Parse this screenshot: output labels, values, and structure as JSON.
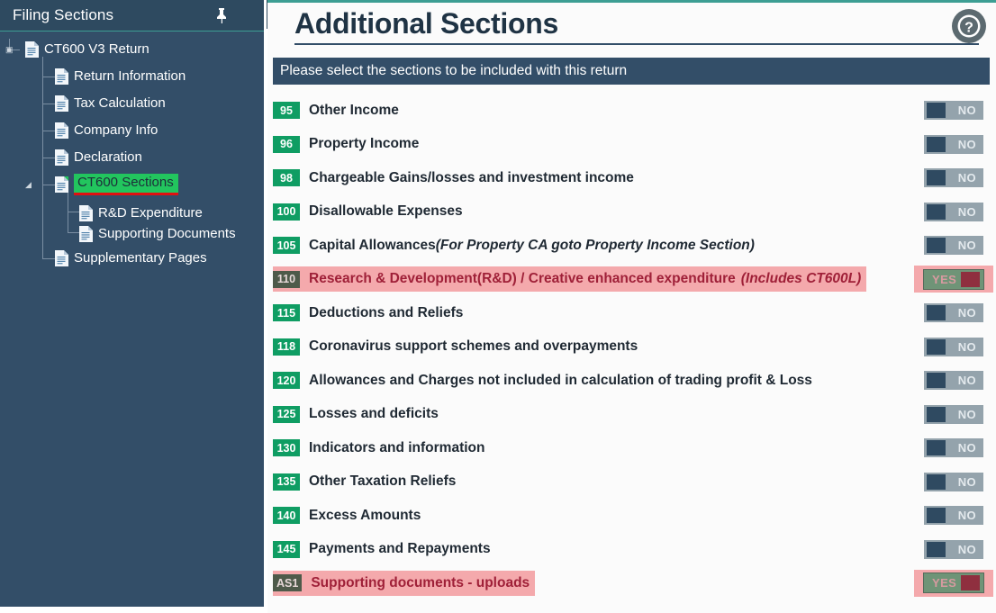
{
  "sidebar": {
    "title": "Filing Sections",
    "pin_icon": "pin-icon",
    "expand_label": "»",
    "tree": [
      {
        "label": "CT600 V3 Return",
        "level": 0,
        "selected": false
      },
      {
        "label": "Return Information",
        "level": 1,
        "selected": false
      },
      {
        "label": "Tax Calculation",
        "level": 1,
        "selected": false
      },
      {
        "label": "Company Info",
        "level": 1,
        "selected": false
      },
      {
        "label": "Declaration",
        "level": 1,
        "selected": false
      },
      {
        "label": "CT600 Sections",
        "level": 1,
        "selected": true
      },
      {
        "label": "R&D Expenditure",
        "level": 2,
        "selected": false
      },
      {
        "label": "Supporting Documents",
        "level": 2,
        "selected": false
      },
      {
        "label": "Supplementary Pages",
        "level": 1,
        "selected": false
      }
    ]
  },
  "main": {
    "page_title": "Additional Sections",
    "help_icon": "help-circle-icon",
    "instruction": "Please select the sections to be included with this return",
    "rows": [
      {
        "code": "95",
        "label": "Other Income",
        "note": "",
        "toggle": "NO",
        "highlight": false,
        "badge_muted": false
      },
      {
        "code": "96",
        "label": "Property Income",
        "note": "",
        "toggle": "NO",
        "highlight": false,
        "badge_muted": false
      },
      {
        "code": "98",
        "label": "Chargeable Gains/losses and investment income",
        "note": "",
        "toggle": "NO",
        "highlight": false,
        "badge_muted": false
      },
      {
        "code": "100",
        "label": "Disallowable Expenses",
        "note": "",
        "toggle": "NO",
        "highlight": false,
        "badge_muted": false
      },
      {
        "code": "105",
        "label": "Capital Allowances",
        "note": "(For Property CA goto Property Income Section)",
        "toggle": "NO",
        "highlight": false,
        "badge_muted": false
      },
      {
        "code": "110",
        "label": "Research & Development(R&D) / Creative enhanced expenditure",
        "note": "(Includes CT600L)",
        "toggle": "YES",
        "highlight": true,
        "badge_muted": true
      },
      {
        "code": "115",
        "label": "Deductions and Reliefs",
        "note": "",
        "toggle": "NO",
        "highlight": false,
        "badge_muted": false
      },
      {
        "code": "118",
        "label": "Coronavirus support schemes and overpayments",
        "note": "",
        "toggle": "NO",
        "highlight": false,
        "badge_muted": false
      },
      {
        "code": "120",
        "label": "Allowances and Charges not included in calculation of trading profit & Loss",
        "note": "",
        "toggle": "NO",
        "highlight": false,
        "badge_muted": false
      },
      {
        "code": "125",
        "label": "Losses and deficits",
        "note": "",
        "toggle": "NO",
        "highlight": false,
        "badge_muted": false
      },
      {
        "code": "130",
        "label": "Indicators and information",
        "note": "",
        "toggle": "NO",
        "highlight": false,
        "badge_muted": false
      },
      {
        "code": "135",
        "label": "Other Taxation Reliefs",
        "note": "",
        "toggle": "NO",
        "highlight": false,
        "badge_muted": false
      },
      {
        "code": "140",
        "label": "Excess Amounts",
        "note": "",
        "toggle": "NO",
        "highlight": false,
        "badge_muted": false
      },
      {
        "code": "145",
        "label": "Payments and Repayments",
        "note": "",
        "toggle": "NO",
        "highlight": false,
        "badge_muted": false
      },
      {
        "code": "AS1",
        "label": "Supporting documents - uploads",
        "note": "",
        "toggle": "YES",
        "highlight": true,
        "badge_muted": true
      }
    ]
  },
  "colors": {
    "sidebar_bg": "#334e68",
    "accent_teal": "#3d9e93",
    "badge_green": "#0f9d63",
    "badge_muted": "#4e5a4a",
    "highlight_pink": "#f4a9ac",
    "highlight_text": "#9f2038",
    "selected_green": "#22c55e",
    "selected_underline": "#e11111",
    "toggle_off_track": "#94a3ac",
    "toggle_off_knob": "#2f4a61",
    "toggle_on_track": "#6f9477",
    "toggle_on_knob": "#8f2f3f"
  }
}
